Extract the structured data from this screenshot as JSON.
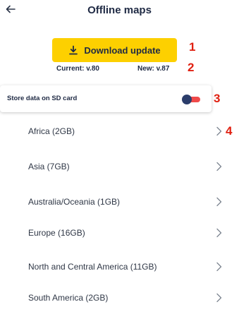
{
  "header": {
    "title": "Offline maps",
    "back_icon": "arrow-left-icon"
  },
  "update": {
    "button_label": "Download update",
    "button_icon": "download-icon",
    "current": "Current: v.80",
    "new": "New: v.87",
    "button_color": "#fdd000"
  },
  "settings": {
    "sd_label": "Store data on SD card",
    "sd_enabled": true,
    "toggle_track_color": "#f04a4a",
    "toggle_knob_color": "#2b3d6b"
  },
  "callouts": [
    "1",
    "2",
    "3",
    "4"
  ],
  "callout_color": "#e01f10",
  "regions": [
    {
      "label": "Africa (2GB)"
    },
    {
      "label": "Asia (7GB)"
    },
    {
      "label": "Australia/Oceania (1GB)"
    },
    {
      "label": "Europe (16GB)"
    },
    {
      "label": "North and Central America (11GB)"
    },
    {
      "label": "South America (2GB)"
    }
  ]
}
